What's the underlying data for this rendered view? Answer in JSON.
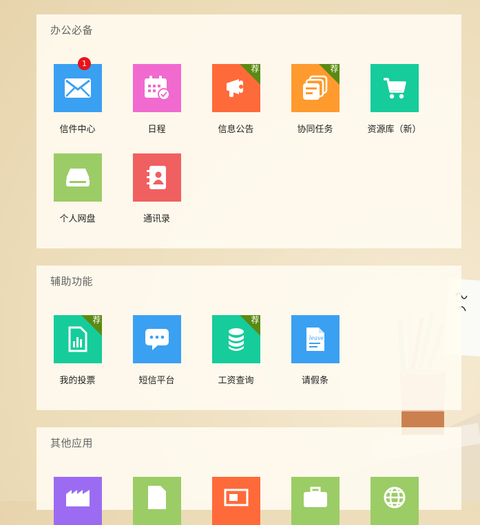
{
  "sections": [
    {
      "title": "办公必备",
      "apps": [
        {
          "label": "信件中心",
          "badge": "1",
          "ribbon": "",
          "color": "#3aa0f2",
          "icon": "envelope-icon"
        },
        {
          "label": "日程",
          "badge": "",
          "ribbon": "",
          "color": "#f06ad0",
          "icon": "calendar-icon"
        },
        {
          "label": "信息公告",
          "badge": "",
          "ribbon": "荐",
          "color": "#ff6a3a",
          "icon": "megaphone-icon"
        },
        {
          "label": "协同任务",
          "badge": "",
          "ribbon": "荐",
          "color": "#ff9a2e",
          "icon": "windows-stack-icon"
        },
        {
          "label": "资源库（新）",
          "badge": "",
          "ribbon": "",
          "color": "#16cc9b",
          "icon": "cart-icon"
        },
        {
          "label": "个人网盘",
          "badge": "",
          "ribbon": "",
          "color": "#9ccc66",
          "icon": "disk-icon"
        },
        {
          "label": "通讯录",
          "badge": "",
          "ribbon": "",
          "color": "#f06060",
          "icon": "contacts-icon"
        }
      ]
    },
    {
      "title": "辅助功能",
      "apps": [
        {
          "label": "我的投票",
          "badge": "",
          "ribbon": "荐",
          "color": "#16cc9b",
          "icon": "vote-chart-icon"
        },
        {
          "label": "短信平台",
          "badge": "",
          "ribbon": "",
          "color": "#3aa0f2",
          "icon": "chat-bubble-icon"
        },
        {
          "label": "工资查询",
          "badge": "",
          "ribbon": "荐",
          "color": "#16cc9b",
          "icon": "coins-icon"
        },
        {
          "label": "请假条",
          "badge": "",
          "ribbon": "",
          "color": "#3aa0f2",
          "icon": "leave-document-icon"
        }
      ]
    },
    {
      "title": "其他应用",
      "apps": [
        {
          "label": "",
          "color": "#9b6cf2",
          "icon": "factory-icon"
        },
        {
          "label": "",
          "color": "#9ccc66",
          "icon": "document-icon"
        },
        {
          "label": "",
          "color": "#ff6a3a",
          "icon": "monitor-icon"
        },
        {
          "label": "",
          "color": "#9ccc66",
          "icon": "briefcase-icon"
        },
        {
          "label": "",
          "color": "#9ccc66",
          "icon": "globe-icon"
        }
      ]
    }
  ],
  "tile_text": {
    "leave": "leave"
  }
}
